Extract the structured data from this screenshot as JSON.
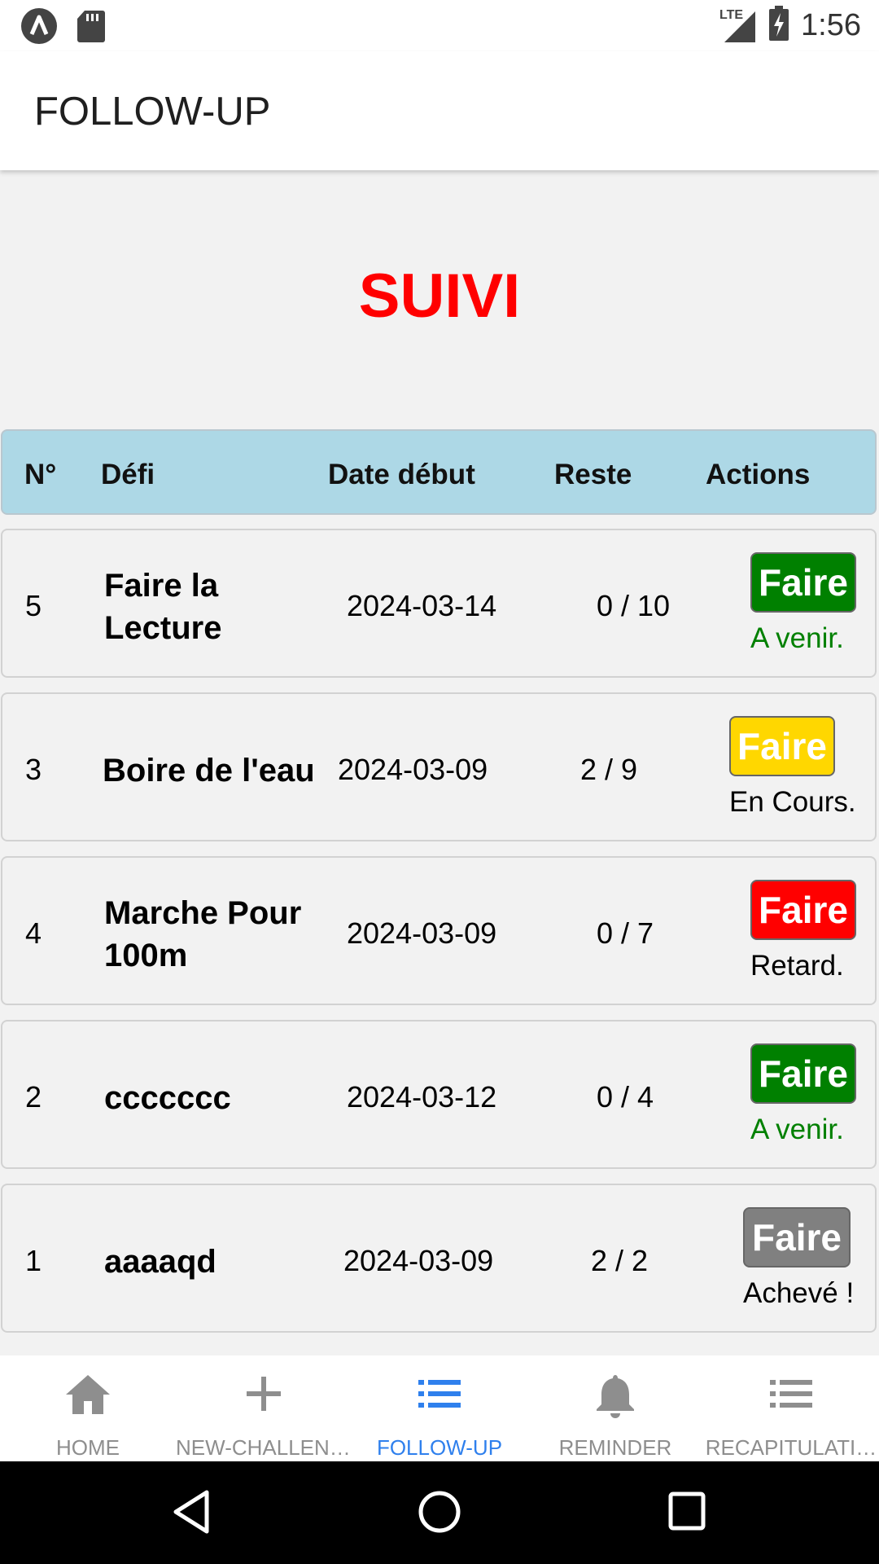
{
  "status_bar": {
    "time": "1:56",
    "network": "LTE",
    "icons": [
      "app-a-icon",
      "sd-card-icon",
      "signal-icon",
      "battery-charging-icon"
    ]
  },
  "app_bar": {
    "title": "FOLLOW-UP"
  },
  "heading": "SUIVI",
  "table": {
    "headers": {
      "num": "N°",
      "defi": "Défi",
      "date": "Date début",
      "reste": "Reste",
      "actions": "Actions"
    },
    "rows": [
      {
        "num": "5",
        "name_line1": "Faire la",
        "name_line2": "Lecture",
        "date": "2024-03-14",
        "reste": "0 / 10",
        "action": "Faire",
        "status": "A venir.",
        "button_color": "#008000",
        "status_color": "#008000"
      },
      {
        "num": "3",
        "name_line1": "Boire de l'eau",
        "name_line2": "",
        "date": "2024-03-09",
        "reste": "2 / 9",
        "action": "Faire",
        "status": "En Cours.",
        "button_color": "#ffd700",
        "status_color": "#000000"
      },
      {
        "num": "4",
        "name_line1": "Marche Pour",
        "name_line2": "100m",
        "date": "2024-03-09",
        "reste": "0 / 7",
        "action": "Faire",
        "status": "Retard.",
        "button_color": "#ff0000",
        "status_color": "#000000"
      },
      {
        "num": "2",
        "name_line1": "ccccccc",
        "name_line2": "",
        "date": "2024-03-12",
        "reste": "0 / 4",
        "action": "Faire",
        "status": "A venir.",
        "button_color": "#008000",
        "status_color": "#008000"
      },
      {
        "num": "1",
        "name_line1": "aaaaqd",
        "name_line2": "",
        "date": "2024-03-09",
        "reste": "2 / 2",
        "action": "Faire",
        "status": "Achevé !",
        "button_color": "#808080",
        "status_color": "#000000"
      }
    ]
  },
  "bottom_nav": {
    "items": [
      {
        "label": "HOME",
        "icon": "home-icon"
      },
      {
        "label": "NEW-CHALLENGE",
        "icon": "plus-icon"
      },
      {
        "label": "FOLLOW-UP",
        "icon": "list-icon",
        "active": true
      },
      {
        "label": "REMINDER",
        "icon": "bell-icon"
      },
      {
        "label": "RECAPITULATI…",
        "icon": "list-alt-icon"
      }
    ],
    "active_color": "#2f80ed",
    "inactive_color": "#8e8e8e"
  },
  "system_nav": {
    "icons": [
      "back-icon",
      "home-circle-icon",
      "recents-icon"
    ]
  },
  "colors": {
    "heading": "#ff0000",
    "table_header_bg": "#add8e6"
  }
}
